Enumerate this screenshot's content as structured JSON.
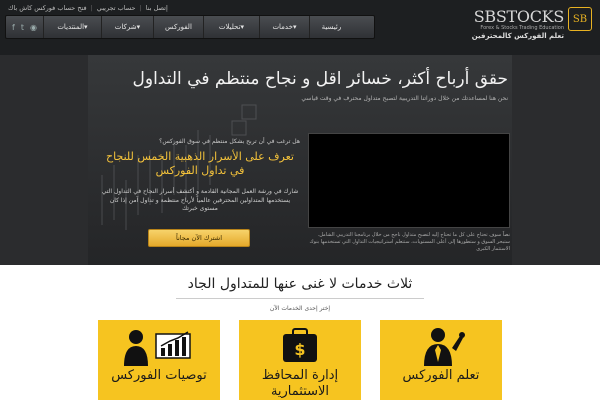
{
  "topbar": {
    "links": [
      "إتصل بنا",
      "حساب تجريبي",
      "فتح حساب فوركس كاش باك"
    ],
    "separators": [
      "|",
      "|"
    ]
  },
  "logo": {
    "name": "SBSTOCKS",
    "badge": "SB",
    "tagline": "Forex & Stocks Trading Education",
    "arabic": "تعلم الفوركس كالمحترفين"
  },
  "nav": {
    "items": [
      "رئيسية",
      "خدمات▾",
      "تحليلات▾",
      "الفوركس",
      "شركات▾",
      "المنتديات▾"
    ],
    "icons": [
      "rss-icon",
      "twitter-icon",
      "facebook-icon"
    ]
  },
  "hero": {
    "title": "حقق أرباح أكثر، خسائر اقل و نجاح منتظم في التداول",
    "subtitle": "نحن هنا لمساعدتك من خلال دوراتنا التدريبية لتصبح متداول محترف في وقت قياسي",
    "question": "هل ترغب في أن تربح بشكل منتظم في سوق الفوركس؟",
    "headline": "تعرف على  الأسرار الذهبية الخمس للنجاح في تداول الفوركس",
    "description": "شارك في ورشة العمل المجانية القادمة و أكتشف أسرار النجاح في التداول التي يستخدمها المتداولين المحترفين عالمياً لأرباح منتظمة و تداول آمن إذا كان مستوى خبرتك",
    "cta": "اشترك الآن مجاناً",
    "video_caption": "نصاً سوف تحتاج على كل ما تحتاج إليه لتصبح متداول ناجح من خلال برنامجنا التدريبي الشامل. ستبحر السوق و ستطورها إلى أعلى المستويات، ستتعلم استراتيجيات التداول التي تستخدمها بنوك الاستثمار الكبرى"
  },
  "services": {
    "title": "ثلاث خدمات لا غنى عنها للمتداول الجاد",
    "subtitle": "إختر إحدى الخدمات الآن",
    "cards": [
      {
        "label": "توصيات الفوركس",
        "icon": "presenter-chart-icon"
      },
      {
        "label": "إدارة المحافظ الاستثمارية",
        "icon": "money-bag-icon"
      },
      {
        "label": "تعلم الفوركس",
        "icon": "businessman-icon"
      }
    ]
  },
  "colors": {
    "accent": "#f6c420",
    "dark": "#1d1f21",
    "headline": "#f5c33b"
  }
}
